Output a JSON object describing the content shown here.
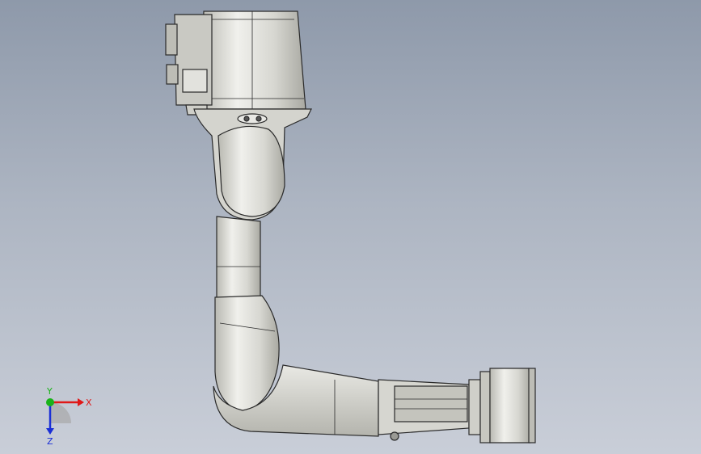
{
  "viewport": {
    "background_top": "#8e99aa",
    "background_bottom": "#c9ced8"
  },
  "model": {
    "part_fill": "#d8d8d2",
    "part_shade": "#b9b9b2",
    "edge_color": "#2a2a2a",
    "shine": "#f2f2ee"
  },
  "triad": {
    "x_label": "X",
    "y_label": "Y",
    "z_label": "Z",
    "x_color": "#e01818",
    "y_color": "#19b319",
    "z_color": "#1a2fd6"
  }
}
